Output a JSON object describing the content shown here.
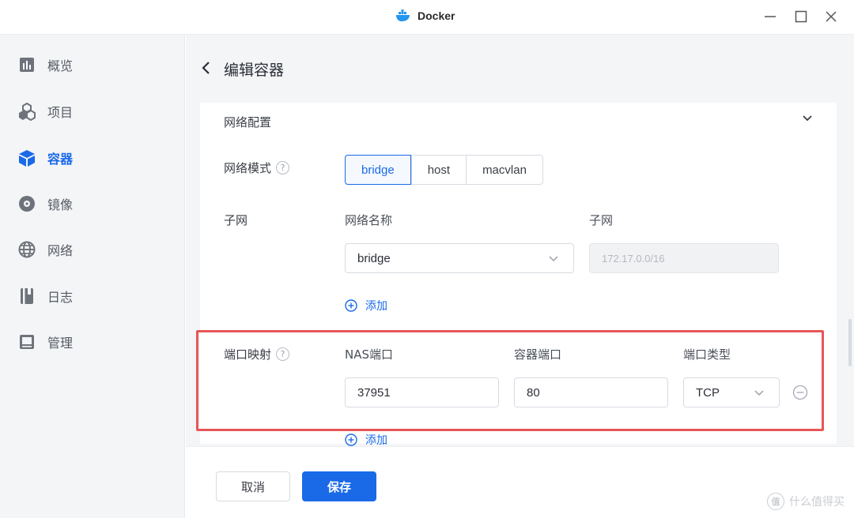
{
  "window": {
    "title": "Docker",
    "icon": "docker-whale-icon",
    "controls": [
      "minimize-icon",
      "maximize-icon",
      "close-icon"
    ]
  },
  "sidebar": {
    "items": [
      {
        "label": "概览",
        "icon": "overview-chart-icon",
        "active": false
      },
      {
        "label": "项目",
        "icon": "project-cubes-icon",
        "active": false
      },
      {
        "label": "容器",
        "icon": "container-cube-icon",
        "active": true
      },
      {
        "label": "镜像",
        "icon": "image-disc-icon",
        "active": false
      },
      {
        "label": "网络",
        "icon": "network-globe-icon",
        "active": false
      },
      {
        "label": "日志",
        "icon": "log-book-icon",
        "active": false
      },
      {
        "label": "管理",
        "icon": "manage-panel-icon",
        "active": false
      }
    ]
  },
  "page": {
    "title": "编辑容器"
  },
  "network": {
    "section_title": "网络配置",
    "mode_label": "网络模式",
    "modes": [
      "bridge",
      "host",
      "macvlan"
    ],
    "selected_mode": "bridge",
    "subnet_label": "子网",
    "col_network_name": "网络名称",
    "col_subnet": "子网",
    "network_name_value": "bridge",
    "subnet_value": "172.17.0.0/16",
    "add_label": "添加"
  },
  "ports": {
    "label": "端口映射",
    "col_nas_port": "NAS端口",
    "col_container_port": "容器端口",
    "col_port_type": "端口类型",
    "rows": [
      {
        "nas_port": "37951",
        "container_port": "80",
        "type": "TCP"
      }
    ],
    "add_label": "添加"
  },
  "footer": {
    "cancel_label": "取消",
    "save_label": "保存"
  },
  "watermark": {
    "text": "什么值得买",
    "logo_text": "值"
  },
  "colors": {
    "accent": "#1a6ae8",
    "highlight": "#e85656",
    "sidebar_bg": "#f4f5f7"
  }
}
